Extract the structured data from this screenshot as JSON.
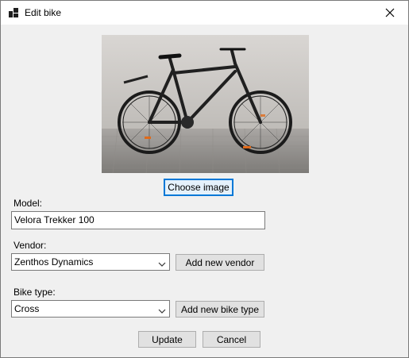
{
  "window": {
    "title": "Edit bike",
    "title_icon": "app-icon",
    "close_icon": "close-icon"
  },
  "image": {
    "description": "bike-photo",
    "choose_button": "Choose image"
  },
  "form": {
    "model_label": "Model:",
    "model_value": "Velora Trekker 100",
    "vendor_label": "Vendor:",
    "vendor_value": "Zenthos Dynamics",
    "add_vendor_button": "Add new vendor",
    "bike_type_label": "Bike type:",
    "bike_type_value": "Cross",
    "add_bike_type_button": "Add new bike type"
  },
  "actions": {
    "update_button": "Update",
    "cancel_button": "Cancel"
  },
  "colors": {
    "accent": "#0078d7",
    "window_bg": "#f0f0f0"
  }
}
